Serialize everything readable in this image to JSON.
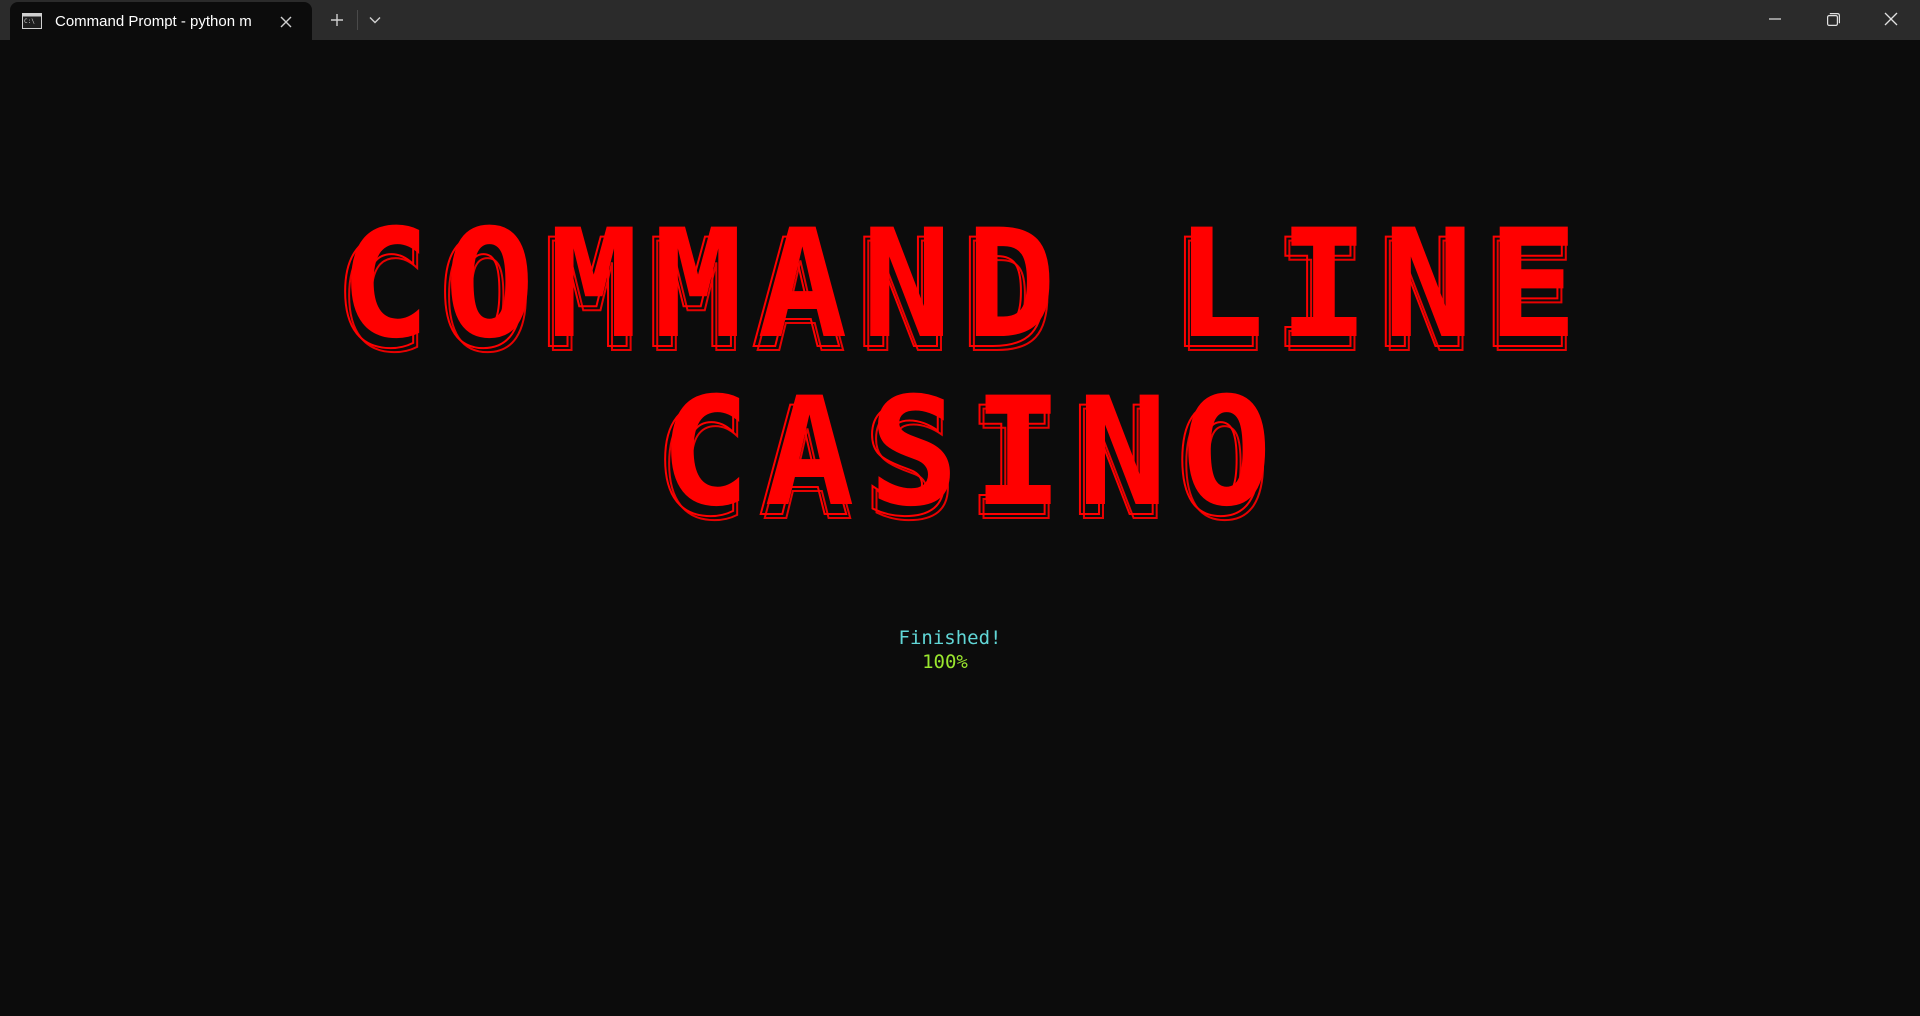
{
  "tab": {
    "title": "Command Prompt - python  m",
    "icon": "terminal-icon"
  },
  "controls": {
    "new_tab_icon": "plus-icon",
    "dropdown_icon": "chevron-down-icon",
    "minimize_icon": "minimize-icon",
    "maximize_icon": "restore-icon",
    "close_icon": "close-icon"
  },
  "terminal": {
    "banner_line1": "COMMAND LINE",
    "banner_line2": "CASINO",
    "status": "Finished!",
    "progress": "100%"
  },
  "colors": {
    "background": "#0c0c0c",
    "titlebar": "#2b2b2b",
    "banner": "#ff0000",
    "status": "#61d6d6",
    "progress": "#9ae62e"
  }
}
